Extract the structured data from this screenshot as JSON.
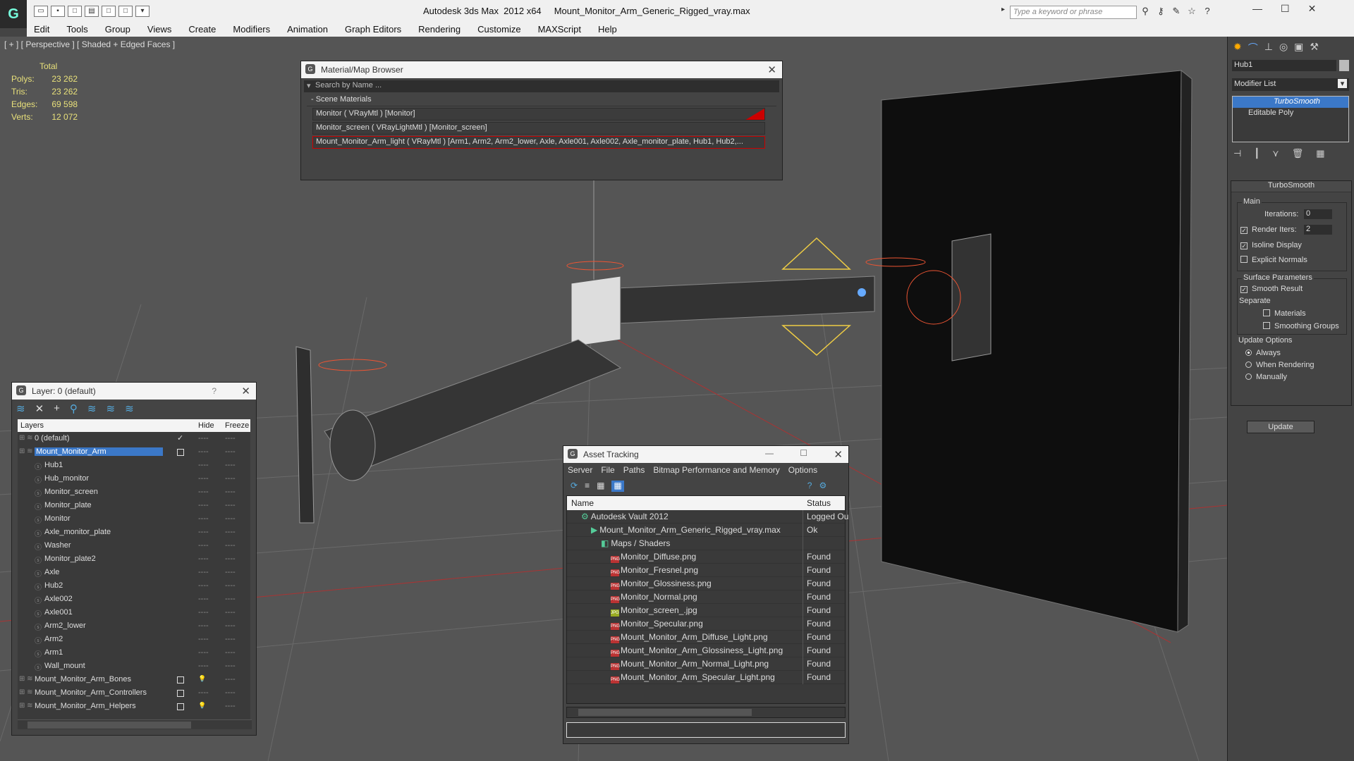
{
  "app": {
    "title": "Autodesk 3ds Max  2012 x64     Mount_Monitor_Arm_Generic_Rigged_vray.max",
    "search_placeholder": "Type a keyword or phrase",
    "logo": "G"
  },
  "menu": [
    "Edit",
    "Tools",
    "Group",
    "Views",
    "Create",
    "Modifiers",
    "Animation",
    "Graph Editors",
    "Rendering",
    "Customize",
    "MAXScript",
    "Help"
  ],
  "viewport": {
    "label": "[ + ] [ Perspective ] [ Shaded + Edged Faces ]",
    "stats": {
      "header": "Total",
      "rows": [
        {
          "k": "Polys:",
          "v": "23 262"
        },
        {
          "k": "Tris:",
          "v": "23 262"
        },
        {
          "k": "Edges:",
          "v": "69 598"
        },
        {
          "k": "Verts:",
          "v": "12 072"
        }
      ]
    }
  },
  "material_browser": {
    "title": "Material/Map Browser",
    "search_placeholder": "Search by Name ...",
    "section": "- Scene Materials",
    "items": [
      "Monitor  ( VRayMtl ) [Monitor]",
      "Monitor_screen  ( VRayLightMtl ) [Monitor_screen]",
      "Mount_Monitor_Arm_light  ( VRayMtl )  [Arm1, Arm2, Arm2_lower, Axle, Axle001, Axle002, Axle_monitor_plate, Hub1, Hub2,..."
    ]
  },
  "layer_manager": {
    "title": "Layer: 0 (default)",
    "help": "?",
    "col_layers": "Layers",
    "col_hide": "Hide",
    "col_freeze": "Freeze",
    "rows": [
      {
        "name": "0 (default)",
        "indent": 1,
        "check": true
      },
      {
        "name": "Mount_Monitor_Arm",
        "indent": 1,
        "selected": true,
        "box": true
      },
      {
        "name": "Hub1",
        "indent": 2
      },
      {
        "name": "Hub_monitor",
        "indent": 2
      },
      {
        "name": "Monitor_screen",
        "indent": 2
      },
      {
        "name": "Monitor_plate",
        "indent": 2
      },
      {
        "name": "Monitor",
        "indent": 2
      },
      {
        "name": "Axle_monitor_plate",
        "indent": 2
      },
      {
        "name": "Washer",
        "indent": 2
      },
      {
        "name": "Monitor_plate2",
        "indent": 2
      },
      {
        "name": "Axle",
        "indent": 2
      },
      {
        "name": "Hub2",
        "indent": 2
      },
      {
        "name": "Axle002",
        "indent": 2
      },
      {
        "name": "Axle001",
        "indent": 2
      },
      {
        "name": "Arm2_lower",
        "indent": 2
      },
      {
        "name": "Arm2",
        "indent": 2
      },
      {
        "name": "Arm1",
        "indent": 2
      },
      {
        "name": "Wall_mount",
        "indent": 2
      },
      {
        "name": "Mount_Monitor_Arm_Bones",
        "indent": 1,
        "box": true,
        "bulb": true
      },
      {
        "name": "Mount_Monitor_Arm_Controllers",
        "indent": 1,
        "box": true
      },
      {
        "name": "Mount_Monitor_Arm_Helpers",
        "indent": 1,
        "box": true,
        "bulb": true
      }
    ]
  },
  "asset_tracking": {
    "title": "Asset Tracking",
    "menu": [
      "Server",
      "File",
      "Paths",
      "Bitmap Performance and Memory",
      "Options"
    ],
    "col_name": "Name",
    "col_status": "Status",
    "rows": [
      {
        "name": "Autodesk Vault 2012",
        "status": "Logged Ou",
        "indent": 1,
        "icon": "vault"
      },
      {
        "name": "Mount_Monitor_Arm_Generic_Rigged_vray.max",
        "status": "Ok",
        "indent": 2,
        "icon": "max"
      },
      {
        "name": "Maps / Shaders",
        "status": "",
        "indent": 3,
        "icon": "maps"
      },
      {
        "name": "Monitor_Diffuse.png",
        "status": "Found",
        "indent": 4,
        "icon": "png"
      },
      {
        "name": "Monitor_Fresnel.png",
        "status": "Found",
        "indent": 4,
        "icon": "png"
      },
      {
        "name": "Monitor_Glossiness.png",
        "status": "Found",
        "indent": 4,
        "icon": "png"
      },
      {
        "name": "Monitor_Normal.png",
        "status": "Found",
        "indent": 4,
        "icon": "png"
      },
      {
        "name": "Monitor_screen_.jpg",
        "status": "Found",
        "indent": 4,
        "icon": "jpg"
      },
      {
        "name": "Monitor_Specular.png",
        "status": "Found",
        "indent": 4,
        "icon": "png"
      },
      {
        "name": "Mount_Monitor_Arm_Diffuse_Light.png",
        "status": "Found",
        "indent": 4,
        "icon": "png"
      },
      {
        "name": "Mount_Monitor_Arm_Glossiness_Light.png",
        "status": "Found",
        "indent": 4,
        "icon": "png"
      },
      {
        "name": "Mount_Monitor_Arm_Normal_Light.png",
        "status": "Found",
        "indent": 4,
        "icon": "png"
      },
      {
        "name": "Mount_Monitor_Arm_Specular_Light.png",
        "status": "Found",
        "indent": 4,
        "icon": "png"
      }
    ]
  },
  "command_panel": {
    "object_name": "Hub1",
    "modifier_list": "Modifier List",
    "stack": [
      "TurboSmooth",
      "Editable Poly"
    ],
    "rollout": "TurboSmooth",
    "main": "Main",
    "iterations_label": "Iterations:",
    "iterations": "0",
    "render_iters_label": "Render Iters:",
    "render_iters": "2",
    "isoline": "Isoline Display",
    "explicit": "Explicit Normals",
    "surface": "Surface Parameters",
    "smooth_result": "Smooth Result",
    "separate": "Separate",
    "materials": "Materials",
    "smoothing_groups": "Smoothing Groups",
    "update_options": "Update Options",
    "always": "Always",
    "when_rendering": "When Rendering",
    "manually": "Manually",
    "update": "Update"
  }
}
